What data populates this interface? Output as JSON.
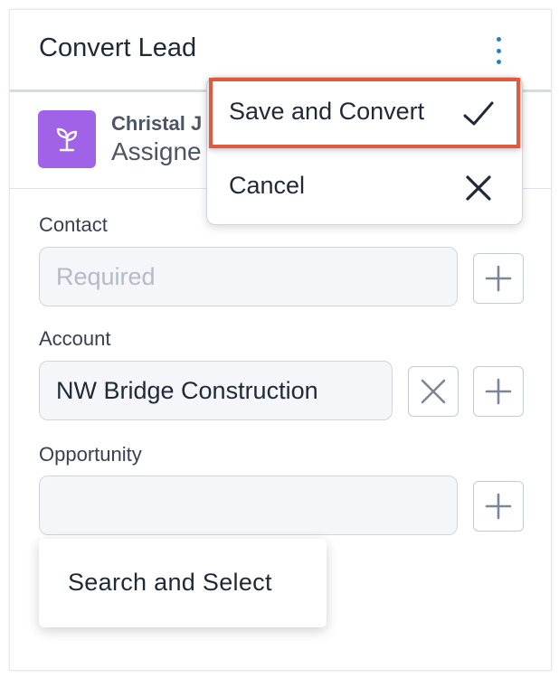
{
  "panel": {
    "title": "Convert Lead",
    "menu_icon": "kebab-menu-icon"
  },
  "assignee": {
    "avatar_icon": "seedling-icon",
    "avatar_color": "#a062e6",
    "name": "Christal J",
    "role": "Assigne"
  },
  "menu": {
    "items": [
      {
        "label": "Save and Convert",
        "icon": "checkmark-icon"
      },
      {
        "label": "Cancel",
        "icon": "close-icon"
      }
    ],
    "highlight_color": "#e05a3d"
  },
  "fields": {
    "contact": {
      "label": "Contact",
      "placeholder": "Required",
      "value": ""
    },
    "account": {
      "label": "Account",
      "value": "NW Bridge Construction"
    },
    "opportunity": {
      "label": "Opportunity",
      "value": ""
    }
  },
  "popup": {
    "label": "Search and Select"
  },
  "colors": {
    "accent": "#1f84c6",
    "input_bg": "#f4f6f9"
  }
}
